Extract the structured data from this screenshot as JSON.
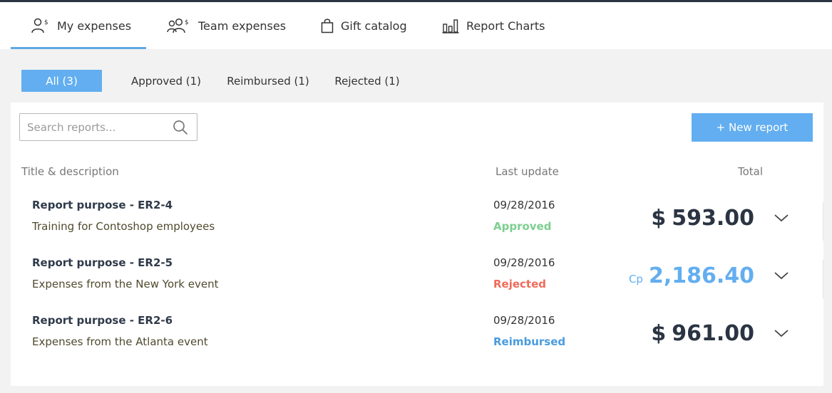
{
  "nav": {
    "tabs": [
      {
        "label": "My expenses",
        "icon": "user-dollar-icon",
        "active": true
      },
      {
        "label": "Team expenses",
        "icon": "team-dollar-icon",
        "active": false
      },
      {
        "label": "Gift catalog",
        "icon": "shopping-bag-icon",
        "active": false
      },
      {
        "label": "Report Charts",
        "icon": "bar-chart-icon",
        "active": false
      }
    ]
  },
  "filters": [
    {
      "label": "All (3)",
      "active": true
    },
    {
      "label": "Approved (1)",
      "active": false
    },
    {
      "label": "Reimbursed (1)",
      "active": false
    },
    {
      "label": "Rejected (1)",
      "active": false
    }
  ],
  "search": {
    "placeholder": "Search reports..."
  },
  "new_report_label": "+ New report",
  "columns": {
    "title": "Title & description",
    "last_update": "Last update",
    "total": "Total"
  },
  "reports": [
    {
      "title": "Report purpose - ER2-4",
      "description": "Training for Contoshop employees",
      "date": "09/28/2016",
      "status": "Approved",
      "status_color": "#7ccf8f",
      "currency": "$",
      "amount": "593.00",
      "amount_color": "#2b3442",
      "currency_style": "inline"
    },
    {
      "title": "Report purpose - ER2-5",
      "description": "Expenses from the New York event",
      "date": "09/28/2016",
      "status": "Rejected",
      "status_color": "#ef6a5a",
      "currency": "Cp",
      "amount": "2,186.40",
      "amount_color": "#62aef0",
      "currency_style": "small"
    },
    {
      "title": "Report purpose - ER2-6",
      "description": "Expenses from the Atlanta event",
      "date": "09/28/2016",
      "status": "Reimbursed",
      "status_color": "#4a9be0",
      "currency": "$",
      "amount": "961.00",
      "amount_color": "#2b3442",
      "currency_style": "inline"
    }
  ],
  "colors": {
    "accent": "#62aef0",
    "dark": "#2b3442"
  }
}
